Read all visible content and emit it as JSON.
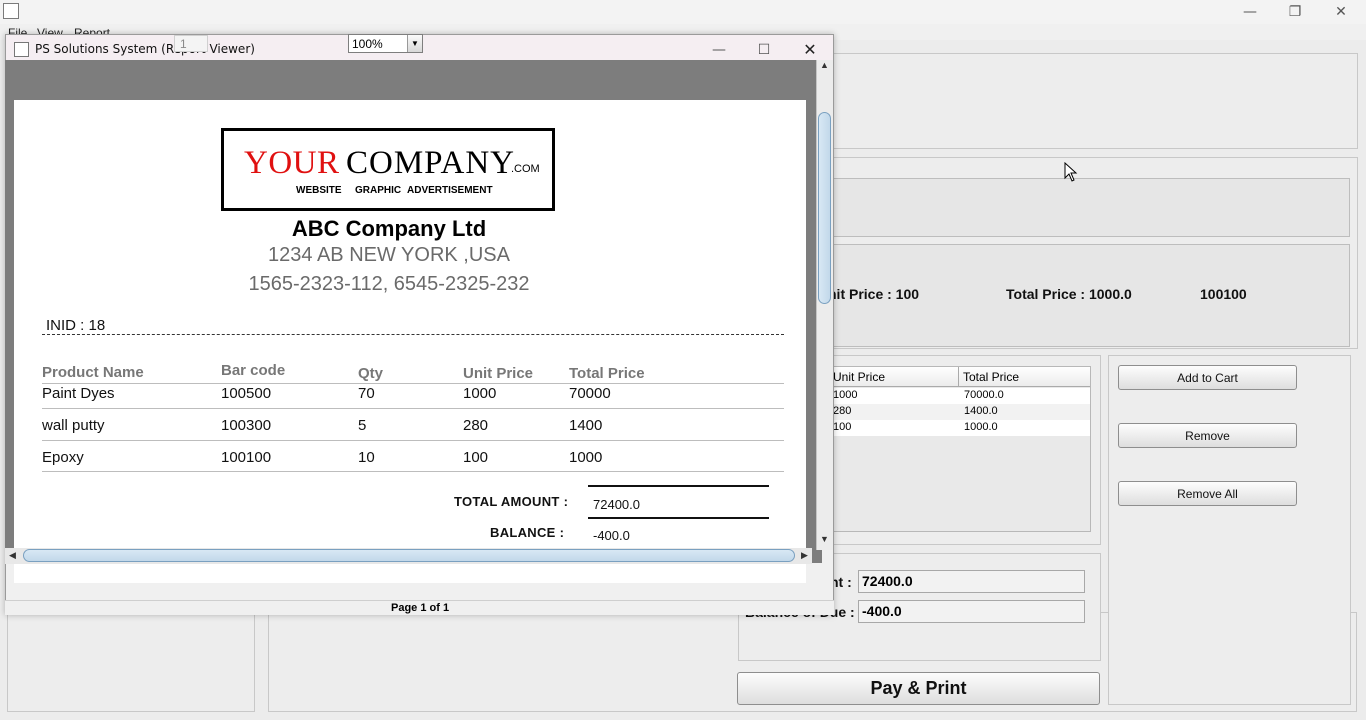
{
  "main_window": {
    "menu": [
      "File",
      "View",
      "Report"
    ],
    "buttons": {
      "add_to_cart": "Add to Cart",
      "remove": "Remove",
      "remove_all": "Remove All",
      "pay_print": "Pay & Print"
    },
    "product_info": {
      "unit_price_text": "nit Price :  100",
      "total_price_text": "Total Price :  1000.0",
      "barcode_text": "100100"
    },
    "cart_table": {
      "headers": [
        "Unit Price",
        "Total Price"
      ],
      "rows": [
        [
          "1000",
          "70000.0"
        ],
        [
          "280",
          "1400.0"
        ],
        [
          "100",
          "1000.0"
        ]
      ]
    },
    "payment": {
      "amount_label": "nt :",
      "amount_value": "72400.0",
      "balance_label": "Balance of Due :",
      "balance_value": "-400.0"
    }
  },
  "viewer": {
    "title": "PS Solutions System (Report Viewer)",
    "page_number": "1",
    "zoom": "100%",
    "status": "Page 1 of 1"
  },
  "report": {
    "logo": {
      "word1": "YOUR",
      "word2": "COMPANY",
      "suffix": ".COM",
      "tags": [
        "WEBSITE",
        "GRAPHIC",
        "ADVERTISEMENT"
      ]
    },
    "company_name": "ABC Company Ltd",
    "address": "1234 AB NEW YORK ,USA",
    "phone": "1565-2323-112, 6545-2325-232",
    "inid": "INID : 18",
    "columns": [
      "Product Name",
      "Bar code",
      "Qty",
      "Unit Price",
      "Total Price"
    ],
    "items": [
      {
        "name": "Paint Dyes",
        "barcode": "100500",
        "qty": "70",
        "unit_price": "1000",
        "total": "70000"
      },
      {
        "name": "wall putty",
        "barcode": "100300",
        "qty": "5",
        "unit_price": "280",
        "total": "1400"
      },
      {
        "name": "Epoxy",
        "barcode": "100100",
        "qty": "10",
        "unit_price": "100",
        "total": "1000"
      }
    ],
    "total_label": "TOTAL AMOUNT :",
    "total_value": "72400.0",
    "balance_label": "BALANCE  :",
    "balance_value": "-400.0"
  }
}
